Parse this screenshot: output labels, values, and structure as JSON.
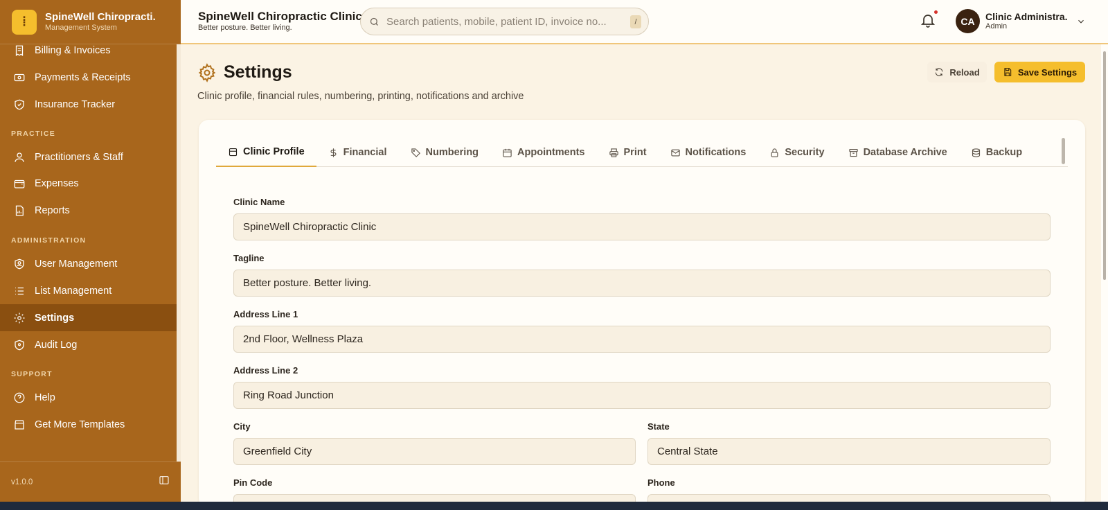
{
  "brand": {
    "name": "SpineWell Chiropracti.",
    "subtitle": "Management System"
  },
  "header": {
    "clinic_name": "SpineWell Chiropractic Clinic",
    "clinic_tagline": "Better posture. Better living.",
    "search_placeholder": "Search patients, mobile, patient ID, invoice no...",
    "search_shortcut": "/",
    "user_initials": "CA",
    "user_name": "Clinic Administra.",
    "user_role": "Admin"
  },
  "sidebar": {
    "items_top": [
      {
        "label": "Billing & Invoices"
      },
      {
        "label": "Payments & Receipts"
      },
      {
        "label": "Insurance Tracker"
      }
    ],
    "section_practice": "PRACTICE",
    "items_practice": [
      {
        "label": "Practitioners & Staff"
      },
      {
        "label": "Expenses"
      },
      {
        "label": "Reports"
      }
    ],
    "section_admin": "ADMINISTRATION",
    "items_admin": [
      {
        "label": "User Management"
      },
      {
        "label": "List Management"
      },
      {
        "label": "Settings",
        "active": true
      },
      {
        "label": "Audit Log"
      }
    ],
    "section_support": "SUPPORT",
    "items_support": [
      {
        "label": "Help"
      },
      {
        "label": "Get More Templates"
      }
    ],
    "version": "v1.0.0"
  },
  "page": {
    "title": "Settings",
    "subtitle": "Clinic profile, financial rules, numbering, printing, notifications and archive",
    "reload_label": "Reload",
    "save_label": "Save Settings"
  },
  "tabs": [
    {
      "label": "Clinic Profile",
      "active": true
    },
    {
      "label": "Financial"
    },
    {
      "label": "Numbering"
    },
    {
      "label": "Appointments"
    },
    {
      "label": "Print"
    },
    {
      "label": "Notifications"
    },
    {
      "label": "Security"
    },
    {
      "label": "Database Archive"
    },
    {
      "label": "Backup"
    }
  ],
  "form": {
    "clinic_name": {
      "label": "Clinic Name",
      "value": "SpineWell Chiropractic Clinic"
    },
    "tagline": {
      "label": "Tagline",
      "value": "Better posture. Better living."
    },
    "address1": {
      "label": "Address Line 1",
      "value": "2nd Floor, Wellness Plaza"
    },
    "address2": {
      "label": "Address Line 2",
      "value": "Ring Road Junction"
    },
    "city": {
      "label": "City",
      "value": "Greenfield City"
    },
    "state": {
      "label": "State",
      "value": "Central State"
    },
    "pin_code": {
      "label": "Pin Code",
      "value": ""
    },
    "phone": {
      "label": "Phone",
      "value": ""
    }
  },
  "colors": {
    "sidebar": "#a8661c",
    "accent": "#f5be2d",
    "background": "#fbf3e4"
  }
}
